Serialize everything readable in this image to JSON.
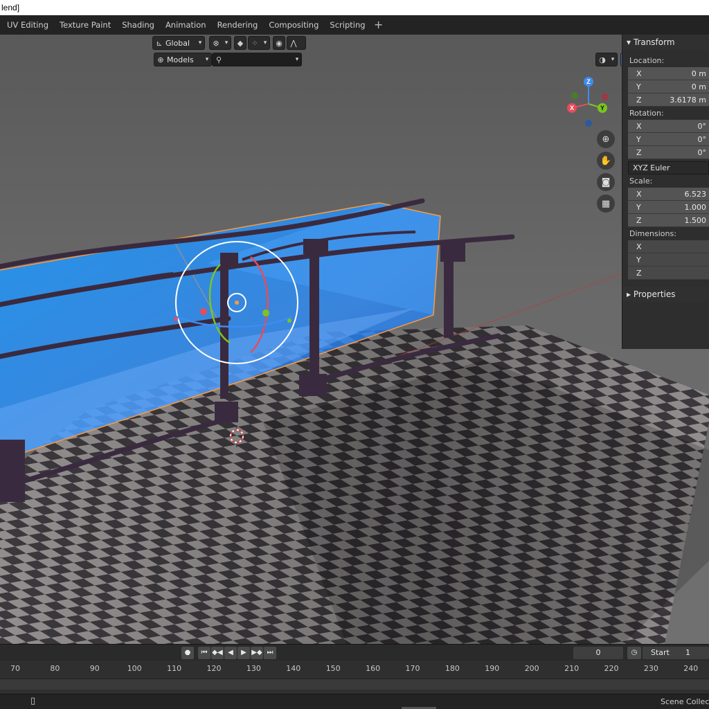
{
  "window": {
    "title": "lend]"
  },
  "workspaces": {
    "tabs": [
      "UV Editing",
      "Texture Paint",
      "Shading",
      "Animation",
      "Rendering",
      "Compositing",
      "Scripting"
    ],
    "add_label": "+"
  },
  "viewport_header": {
    "orientation": "Global",
    "search_scope": "Models",
    "search_placeholder": ""
  },
  "npanel": {
    "transform_title": "Transform",
    "location_label": "Location:",
    "location": [
      {
        "axis": "X",
        "value": "0 m"
      },
      {
        "axis": "Y",
        "value": "0 m"
      },
      {
        "axis": "Z",
        "value": "3.6178 m"
      }
    ],
    "rotation_label": "Rotation:",
    "rotation": [
      {
        "axis": "X",
        "value": "0°"
      },
      {
        "axis": "Y",
        "value": "0°"
      },
      {
        "axis": "Z",
        "value": "0°"
      }
    ],
    "rotation_mode": "XYZ Euler",
    "scale_label": "Scale:",
    "scale": [
      {
        "axis": "X",
        "value": "6.523"
      },
      {
        "axis": "Y",
        "value": "1.000"
      },
      {
        "axis": "Z",
        "value": "1.500"
      }
    ],
    "dimensions_label": "Dimensions:",
    "dimensions": [
      {
        "axis": "X",
        "value": ""
      },
      {
        "axis": "Y",
        "value": ""
      },
      {
        "axis": "Z",
        "value": ""
      }
    ],
    "properties_title": "Properties"
  },
  "gizmo": {
    "x": "X",
    "y": "Y",
    "z": "Z"
  },
  "playback": {
    "current_frame": "0",
    "start_label": "Start",
    "start_value": "1"
  },
  "timeline": {
    "ticks": [
      "70",
      "80",
      "90",
      "100",
      "110",
      "120",
      "130",
      "140",
      "150",
      "160",
      "170",
      "180",
      "190",
      "200",
      "210",
      "220",
      "230",
      "240"
    ]
  },
  "statusbar": {
    "collection_text": "Scene Collection"
  },
  "colors": {
    "selection_blue": "#1e90ff",
    "outline_orange": "#ff9a3c",
    "axis_x": "#e64c5a",
    "axis_y": "#7cc423",
    "axis_z": "#3c8cf0"
  }
}
